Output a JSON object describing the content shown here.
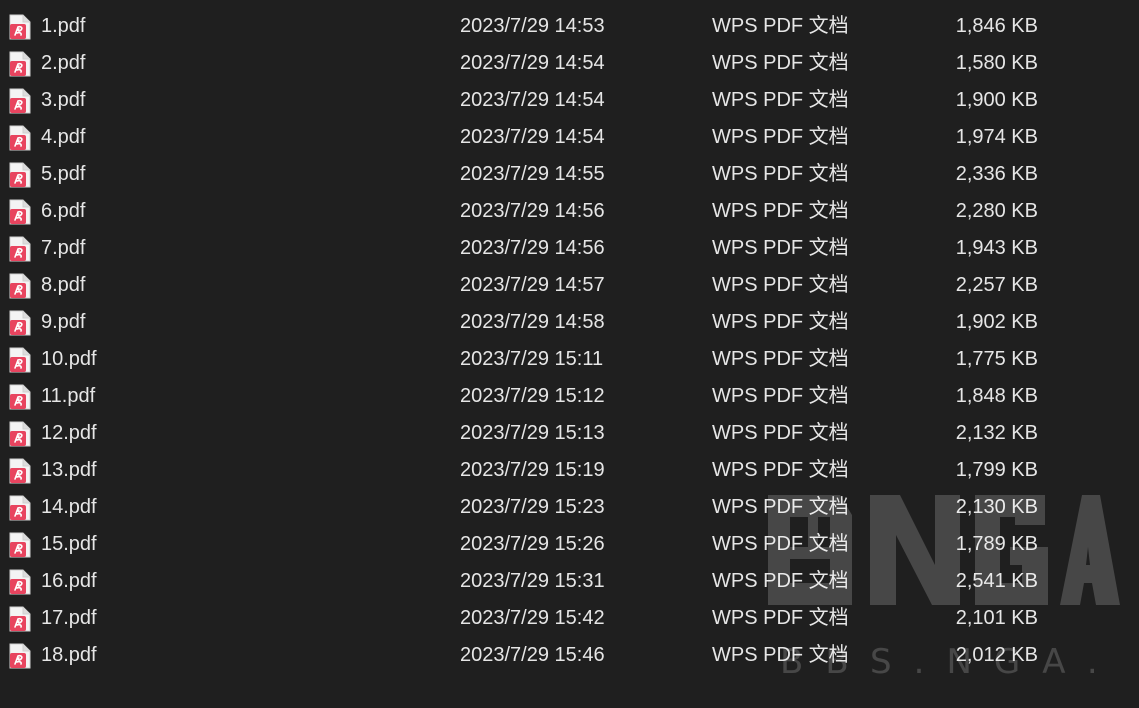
{
  "files": [
    {
      "name": "1.pdf",
      "date": "2023/7/29 14:53",
      "type": "WPS PDF 文档",
      "size": "1,846 KB",
      "icon": "wps-pdf-icon"
    },
    {
      "name": "2.pdf",
      "date": "2023/7/29 14:54",
      "type": "WPS PDF 文档",
      "size": "1,580 KB",
      "icon": "wps-pdf-icon"
    },
    {
      "name": "3.pdf",
      "date": "2023/7/29 14:54",
      "type": "WPS PDF 文档",
      "size": "1,900 KB",
      "icon": "wps-pdf-icon"
    },
    {
      "name": "4.pdf",
      "date": "2023/7/29 14:54",
      "type": "WPS PDF 文档",
      "size": "1,974 KB",
      "icon": "wps-pdf-icon"
    },
    {
      "name": "5.pdf",
      "date": "2023/7/29 14:55",
      "type": "WPS PDF 文档",
      "size": "2,336 KB",
      "icon": "wps-pdf-icon"
    },
    {
      "name": "6.pdf",
      "date": "2023/7/29 14:56",
      "type": "WPS PDF 文档",
      "size": "2,280 KB",
      "icon": "wps-pdf-icon"
    },
    {
      "name": "7.pdf",
      "date": "2023/7/29 14:56",
      "type": "WPS PDF 文档",
      "size": "1,943 KB",
      "icon": "wps-pdf-icon"
    },
    {
      "name": "8.pdf",
      "date": "2023/7/29 14:57",
      "type": "WPS PDF 文档",
      "size": "2,257 KB",
      "icon": "wps-pdf-icon"
    },
    {
      "name": "9.pdf",
      "date": "2023/7/29 14:58",
      "type": "WPS PDF 文档",
      "size": "1,902 KB",
      "icon": "wps-pdf-icon"
    },
    {
      "name": "10.pdf",
      "date": "2023/7/29 15:11",
      "type": "WPS PDF 文档",
      "size": "1,775 KB",
      "icon": "wps-pdf-icon"
    },
    {
      "name": "11.pdf",
      "date": "2023/7/29 15:12",
      "type": "WPS PDF 文档",
      "size": "1,848 KB",
      "icon": "wps-pdf-icon"
    },
    {
      "name": "12.pdf",
      "date": "2023/7/29 15:13",
      "type": "WPS PDF 文档",
      "size": "2,132 KB",
      "icon": "wps-pdf-icon"
    },
    {
      "name": "13.pdf",
      "date": "2023/7/29 15:19",
      "type": "WPS PDF 文档",
      "size": "1,799 KB",
      "icon": "wps-pdf-icon"
    },
    {
      "name": "14.pdf",
      "date": "2023/7/29 15:23",
      "type": "WPS PDF 文档",
      "size": "2,130 KB",
      "icon": "wps-pdf-icon"
    },
    {
      "name": "15.pdf",
      "date": "2023/7/29 15:26",
      "type": "WPS PDF 文档",
      "size": "1,789 KB",
      "icon": "wps-pdf-icon"
    },
    {
      "name": "16.pdf",
      "date": "2023/7/29 15:31",
      "type": "WPS PDF 文档",
      "size": "2,541 KB",
      "icon": "wps-pdf-icon"
    },
    {
      "name": "17.pdf",
      "date": "2023/7/29 15:42",
      "type": "WPS PDF 文档",
      "size": "2,101 KB",
      "icon": "wps-pdf-icon"
    },
    {
      "name": "18.pdf",
      "date": "2023/7/29 15:46",
      "type": "WPS PDF 文档",
      "size": "2,012 KB",
      "icon": "wps-pdf-icon"
    }
  ],
  "watermark": {
    "brand": "NGA",
    "url": "BBS.NGA.CN"
  },
  "colors": {
    "background": "#1f1f1f",
    "text": "#e6e6e6",
    "pdf_icon_accent": "#e8445f"
  }
}
